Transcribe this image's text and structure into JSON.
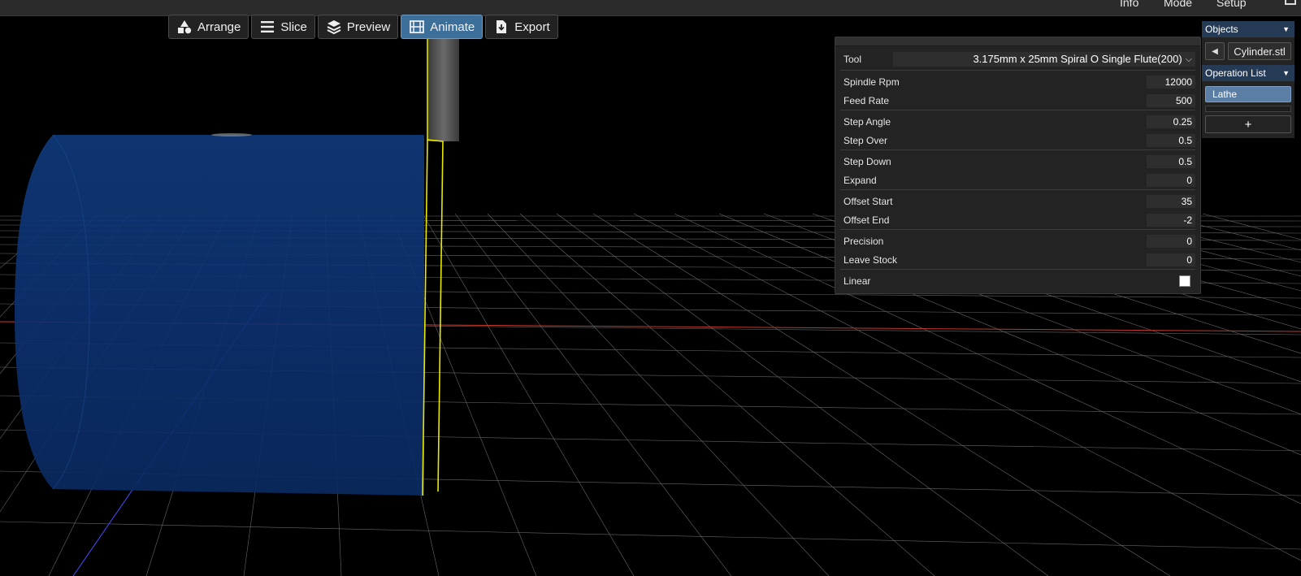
{
  "menu": {
    "items": [
      "Info",
      "Mode",
      "Setup"
    ],
    "icon": "layout-icon"
  },
  "toolbar": {
    "buttons": [
      {
        "label": "Arrange",
        "icon": "shapes-icon",
        "active": false
      },
      {
        "label": "Slice",
        "icon": "lines-icon",
        "active": false
      },
      {
        "label": "Preview",
        "icon": "layers-icon",
        "active": false
      },
      {
        "label": "Animate",
        "icon": "film-icon",
        "active": true
      },
      {
        "label": "Export",
        "icon": "download-file-icon",
        "active": false
      }
    ]
  },
  "panel": {
    "tool_label": "Tool",
    "tool_value": "3.175mm x 25mm Spiral O Single Flute(200)",
    "params": [
      {
        "label": "Spindle Rpm",
        "value": "12000"
      },
      {
        "label": "Feed Rate",
        "value": "500"
      },
      {
        "label": "Step Angle",
        "value": "0.25"
      },
      {
        "label": "Step Over",
        "value": "0.5"
      },
      {
        "label": "Step Down",
        "value": "0.5"
      },
      {
        "label": "Expand",
        "value": "0"
      },
      {
        "label": "Offset Start",
        "value": "35"
      },
      {
        "label": "Offset End",
        "value": "-2"
      },
      {
        "label": "Precision",
        "value": "0"
      },
      {
        "label": "Leave Stock",
        "value": "0"
      }
    ],
    "linear_label": "Linear",
    "linear_checked": false
  },
  "sidebar": {
    "objects_title": "Objects",
    "object_file": "Cylinder.stl",
    "operations_title": "Operation List",
    "operations": [
      "Lathe"
    ],
    "add_label": "+"
  },
  "colors": {
    "accent": "#3c6f9a",
    "cylinder": "#0d2f66",
    "tool_outline": "#e8e800",
    "grid": "#8a8a8a",
    "x_axis": "#c0392b",
    "z_axis": "#4a4aff"
  }
}
